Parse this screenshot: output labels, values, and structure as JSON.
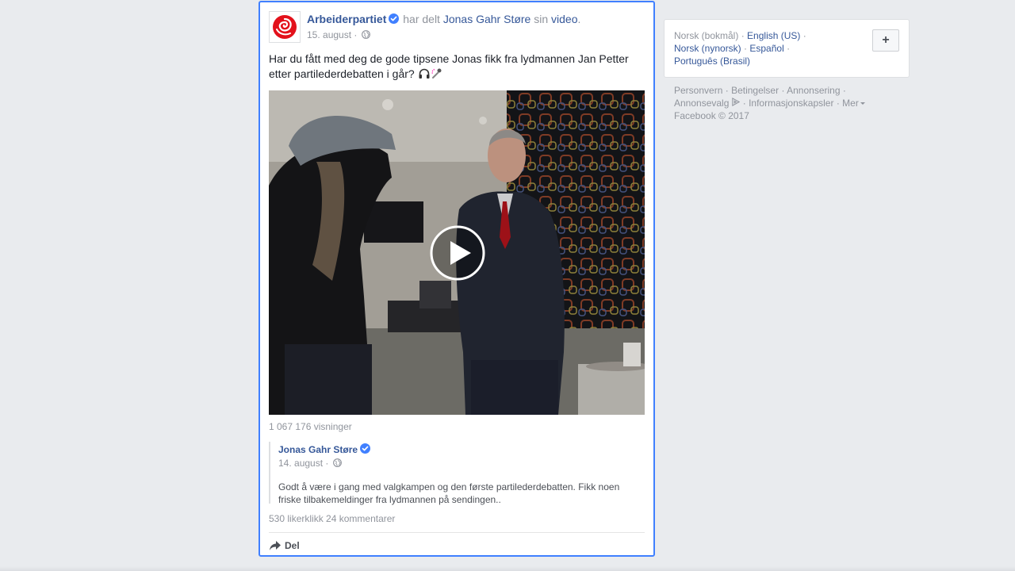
{
  "post": {
    "page_name": "Arbeiderpartiet",
    "shared_text": "har delt",
    "shared_person": "Jonas Gahr Støre",
    "sin_text": "sin",
    "video_link": "video",
    "period": ".",
    "date": "15. august",
    "date_sep": "·",
    "text": "Har du fått med deg de gode tipsene Jonas fikk fra lydmannen Jan Petter etter partilederdebatten i går?",
    "emoji_icons": [
      "headphones-icon",
      "microphone-icon"
    ],
    "views": "1 067 176 visninger",
    "shared_post": {
      "author": "Jonas Gahr Støre",
      "date": "14. august",
      "date_sep": "·",
      "text": "Godt å være i gang med valgkampen og den første partilederdebatten. Fikk noen friske tilbakemeldinger fra lydmannen på sendingen.."
    },
    "likes": "530 likerklikk",
    "comments": "24 kommentarer",
    "share_label": "Del"
  },
  "languages": {
    "current": "Norsk (bokmål)",
    "sep": "·",
    "options": [
      "English (US)",
      "Norsk (nynorsk)",
      "Español",
      "Português (Brasil)"
    ],
    "add_label": "+"
  },
  "footer": {
    "links": [
      "Personvern",
      "Betingelser",
      "Annonsering",
      "Annonsevalg",
      "Informasjonskapsler",
      "Mer"
    ],
    "sep": "·",
    "copyright": "Facebook © 2017"
  },
  "colors": {
    "link": "#365899",
    "focus_border": "#4080ff",
    "verified": "#4080ff",
    "page_bg": "#e9ebee",
    "muted": "#90949c"
  }
}
